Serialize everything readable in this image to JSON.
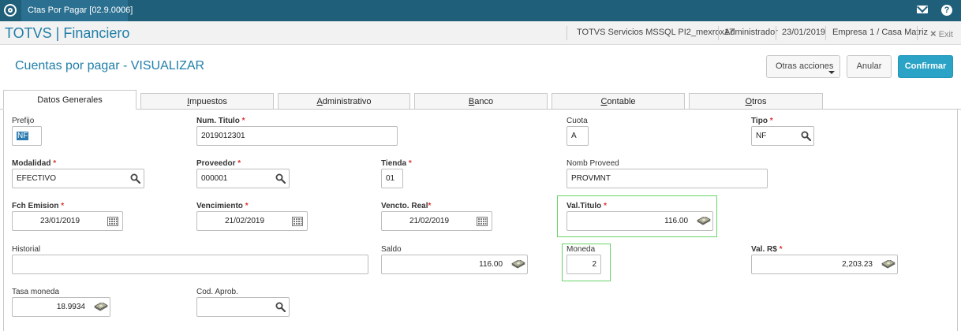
{
  "topbar": {
    "tab_label": "Ctas Por Pagar [02.9.0006]",
    "tab_close": "×"
  },
  "appbar": {
    "title": "TOTVS | Financiero",
    "server": "TOTVS Servicios MSSQL PI2_mexrox17",
    "user": "Administrador",
    "date": "23/01/2019",
    "company": "Empresa 1 / Casa Matriz",
    "exit_label": "Exit",
    "exit_icon": "×"
  },
  "page": {
    "title": "Cuentas por pagar - VISUALIZAR"
  },
  "actions": {
    "otras": "Otras acciones",
    "anular": "Anular",
    "confirmar": "Confirmar"
  },
  "tabs": {
    "datos": "Datos Generales",
    "impuestos_u": "I",
    "impuestos_r": "mpuestos",
    "administrativo_u": "A",
    "administrativo_r": "dministrativo",
    "banco_u": "B",
    "banco_r": "anco",
    "contable_u": "C",
    "contable_r": "ontable",
    "otros_u": "O",
    "otros_r": "tros"
  },
  "form": {
    "prefijo": {
      "label": "Prefijo",
      "value": "NF"
    },
    "num_titulo": {
      "label": "Num. Titulo",
      "required": "*",
      "value": "2019012301"
    },
    "cuota": {
      "label": "Cuota",
      "value": "A"
    },
    "tipo": {
      "label": "Tipo",
      "required": "*",
      "value": "NF"
    },
    "modalidad": {
      "label": "Modalidad",
      "required": "*",
      "value": "EFECTIVO"
    },
    "proveedor": {
      "label": "Proveedor",
      "required": "*",
      "value": "000001"
    },
    "tienda": {
      "label": "Tienda",
      "required": "*",
      "value": "01"
    },
    "nomb_proveed": {
      "label": "Nomb Proveed",
      "value": "PROVMNT"
    },
    "fch_emision": {
      "label": "Fch Emision",
      "required": "*",
      "value": "23/01/2019"
    },
    "vencimiento": {
      "label": "Vencimiento",
      "required": "*",
      "value": "21/02/2019"
    },
    "vencto_real": {
      "label": "Vencto. Real",
      "required": "*",
      "value": "21/02/2019"
    },
    "val_titulo": {
      "label": "Val.Titulo",
      "required": "*",
      "value": "116.00"
    },
    "historial": {
      "label": "Historial",
      "value": ""
    },
    "saldo": {
      "label": "Saldo",
      "value": "116.00"
    },
    "moneda": {
      "label": "Moneda",
      "value": "2"
    },
    "val_rs": {
      "label": "Val. R$",
      "required": "*",
      "value": "2,203.23"
    },
    "tasa_moneda": {
      "label": "Tasa moneda",
      "value": "18.9934"
    },
    "cod_aprob": {
      "label": "Cod. Aprob.",
      "value": ""
    }
  },
  "colors": {
    "brand_dark": "#1f5f7a",
    "brand_text": "#1f7ea8",
    "primary_button": "#2aa3c6",
    "required": "#e03030",
    "highlight": "#66d466"
  },
  "icons": [
    "app-logo-icon",
    "mail-icon",
    "help-icon",
    "exit-icon",
    "search-icon",
    "calendar-icon",
    "money-icon",
    "dropdown-caret-icon"
  ]
}
